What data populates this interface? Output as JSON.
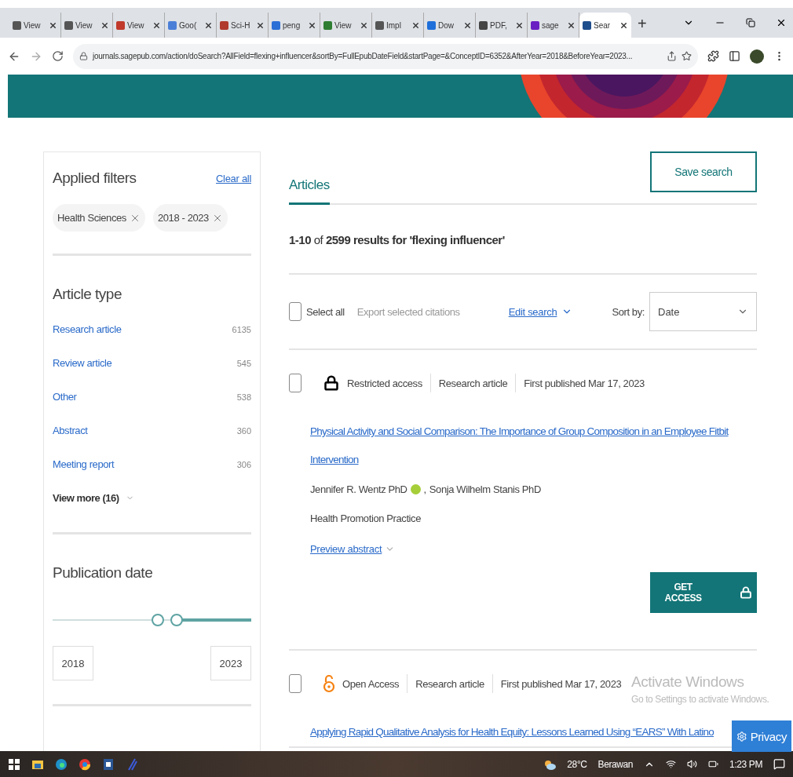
{
  "browser": {
    "tabs": [
      {
        "label": "View",
        "selected": false,
        "color": "#555555"
      },
      {
        "label": "View",
        "selected": false,
        "color": "#555555"
      },
      {
        "label": "View",
        "selected": false,
        "color": "#c0392b"
      },
      {
        "label": "Goo(",
        "selected": false,
        "color": "#4a7fd8"
      },
      {
        "label": "Sci-H",
        "selected": false,
        "color": "#b03a2e"
      },
      {
        "label": "peng",
        "selected": false,
        "color": "#2a6fd6"
      },
      {
        "label": "View",
        "selected": false,
        "color": "#2e7d32"
      },
      {
        "label": "Impl",
        "selected": false,
        "color": "#555555"
      },
      {
        "label": "Dow",
        "selected": false,
        "color": "#1e6fd9"
      },
      {
        "label": "PDF,",
        "selected": false,
        "color": "#444444"
      },
      {
        "label": "sage",
        "selected": false,
        "color": "#6a1fc2"
      },
      {
        "label": "Sear",
        "selected": true,
        "color": "#1f4e8c"
      }
    ],
    "new_tab": "+",
    "address": "journals.sagepub.com/action/doSearch?AllField=flexing+influencer&sortBy=FullEpubDateField&startPage=&ConceptID=6352&AfterYear=2018&BeforeYear=2023..."
  },
  "sidebar": {
    "applied_filters": {
      "title": "Applied filters",
      "clear": "Clear all",
      "chips": [
        "Health Sciences",
        "2018 - 2023"
      ]
    },
    "article_type": {
      "title": "Article type",
      "items": [
        {
          "label": "Research article",
          "count": "6135"
        },
        {
          "label": "Review article",
          "count": "545"
        },
        {
          "label": "Other",
          "count": "538"
        },
        {
          "label": "Abstract",
          "count": "360"
        },
        {
          "label": "Meeting report",
          "count": "306"
        }
      ],
      "more": "View more (16)"
    },
    "publication_date": {
      "title": "Publication date",
      "from": "2018",
      "to": "2023"
    }
  },
  "main": {
    "tabs": [
      {
        "label": "Articles",
        "selected": true
      }
    ],
    "save_button": "Save search",
    "summary": "**1-10** of **2599 results for 'flexing influencer'**",
    "toolbar": {
      "select_all": {
        "label": "Select all",
        "checked": false
      },
      "export": {
        "label": "Export selected citations",
        "disabled": true
      },
      "edit_search": "Edit search",
      "sort_label": "Sort by:",
      "sort_value": "Date"
    },
    "results": [
      {
        "checked": false,
        "access": {
          "kind": "restricted",
          "label": "Restricted access"
        },
        "type": "Research article",
        "date": "First published Mar 17, 2023",
        "title": "Physical Activity and Social Comparison: The Importance of Group Composition in an Employee Fitbit Intervention",
        "authors": [
          {
            "name": "Jennifer R. Wentz PhD",
            "orcid": true,
            "separator": ","
          },
          {
            "name": "Sonja Wilhelm Stanis PhD",
            "orcid": false
          }
        ],
        "journal": "Health Promotion Practice",
        "preview": "Preview abstract",
        "action": "GET ACCESS"
      },
      {
        "checked": false,
        "access": {
          "kind": "open",
          "label": "Open Access"
        },
        "type": "Research article",
        "date": "First published Mar 17, 2023",
        "title": "Applying Rapid Qualitative Analysis for Health Equity: Lessons Learned Using “EARS” With Latino"
      }
    ]
  },
  "overlay": {
    "activation": {
      "title": "Activate Windows",
      "text": "Go to Settings to activate Windows."
    },
    "privacy": "Privacy"
  },
  "taskbar": {
    "temperature": "28°C",
    "weather": "Berawan",
    "time": "1:23 PM"
  }
}
